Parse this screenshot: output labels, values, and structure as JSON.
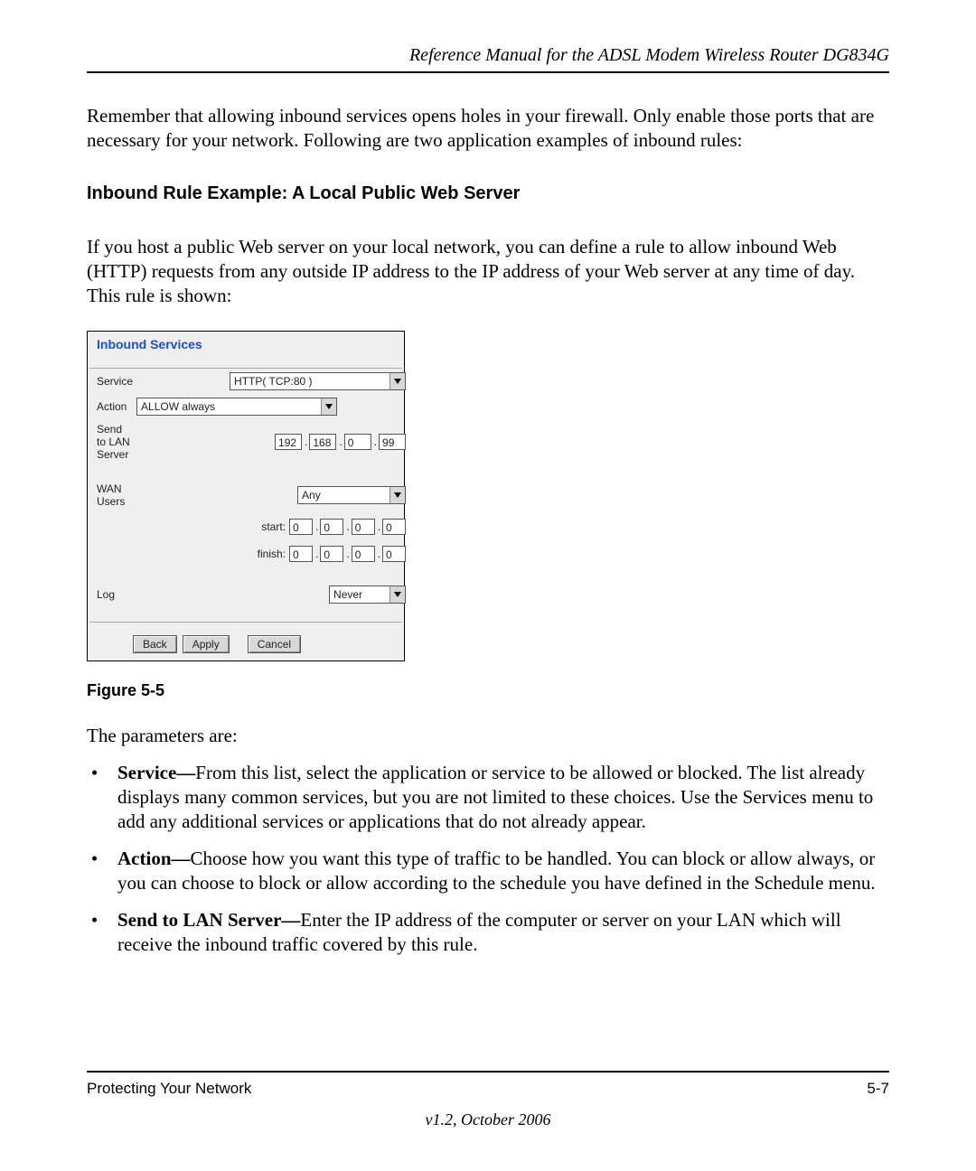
{
  "header": {
    "title": "Reference Manual for the ADSL Modem Wireless Router DG834G"
  },
  "intro_paragraph": "Remember that allowing inbound services opens holes in your firewall. Only enable those ports that are necessary for your network. Following are two application examples of inbound rules:",
  "section_heading": "Inbound Rule Example: A Local Public Web Server",
  "section_paragraph": "If you host a public Web server on your local network, you can define a rule to allow inbound Web (HTTP) requests from any outside IP address to the IP address of your Web server at any time of day. This rule is shown:",
  "figure": {
    "title": "Inbound Services",
    "rows": {
      "service": {
        "label": "Service",
        "value": "HTTP( TCP:80 )"
      },
      "action": {
        "label": "Action",
        "value": "ALLOW always"
      },
      "send_to": {
        "label": "Send to LAN Server",
        "ip": [
          "192",
          "168",
          "0",
          "99"
        ]
      },
      "wan_users": {
        "label": "WAN Users",
        "value": "Any",
        "start_label": "start:",
        "start_ip": [
          "0",
          "0",
          "0",
          "0"
        ],
        "finish_label": "finish:",
        "finish_ip": [
          "0",
          "0",
          "0",
          "0"
        ]
      },
      "log": {
        "label": "Log",
        "value": "Never"
      }
    },
    "buttons": {
      "back": "Back",
      "apply": "Apply",
      "cancel": "Cancel"
    }
  },
  "figure_caption": "Figure 5-5",
  "params_intro": "The parameters are:",
  "params": [
    {
      "name": "Service—",
      "text": "From this list, select the application or service to be allowed or blocked. The list already displays many common services, but you are not limited to these choices. Use the Services menu to add any additional services or applications that do not already appear."
    },
    {
      "name": "Action—",
      "text": "Choose how you want this type of traffic to be handled. You can block or allow always, or you can choose to block or allow according to the schedule you have defined in the Schedule menu."
    },
    {
      "name": "Send to LAN Server—",
      "text": "Enter the IP address of the computer or server on your LAN which will receive the inbound traffic covered by this rule."
    }
  ],
  "footer": {
    "left": "Protecting Your Network",
    "right": "5-7",
    "version": "v1.2, October 2006"
  }
}
